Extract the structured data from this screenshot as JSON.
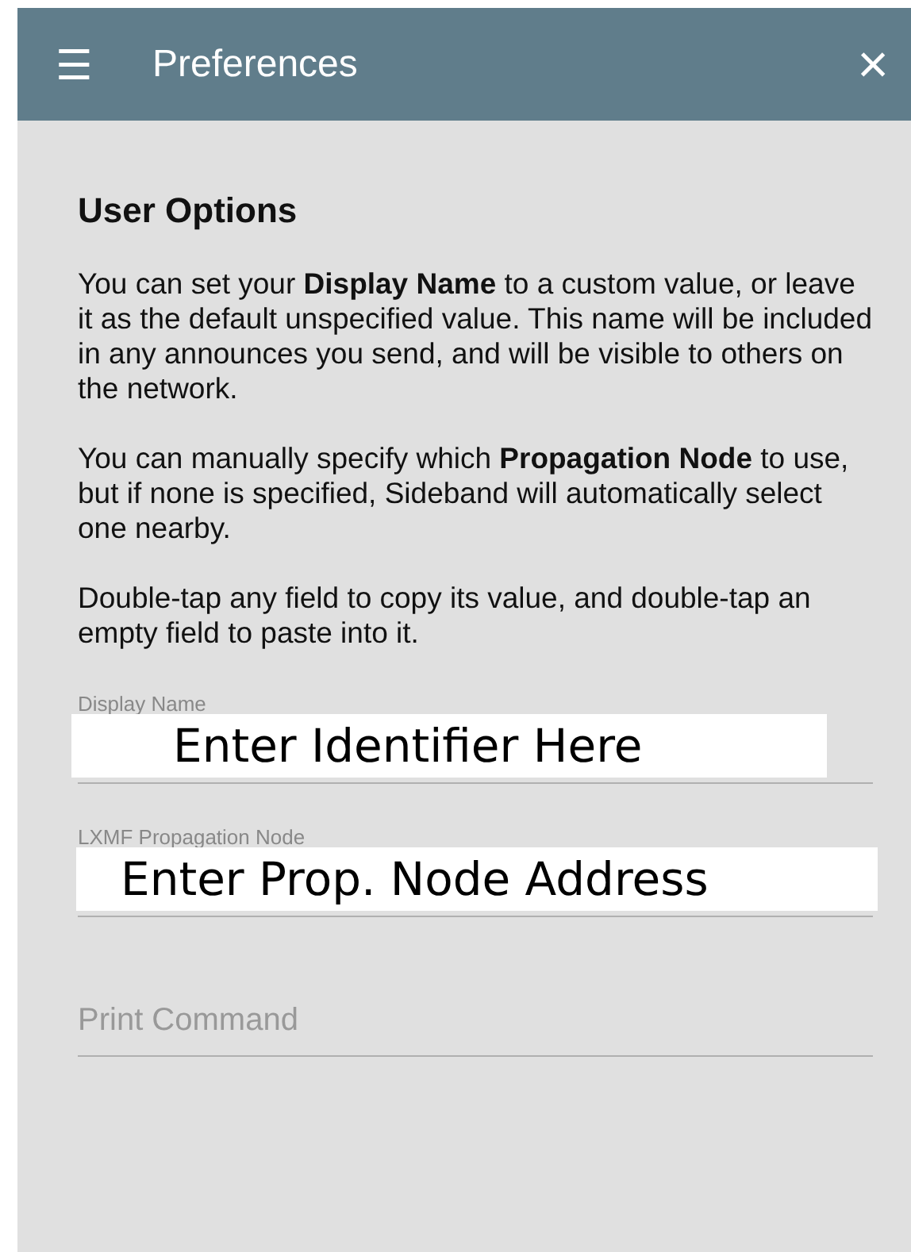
{
  "toolbar": {
    "menu_icon": "☰",
    "title": "Preferences",
    "close_icon": "×"
  },
  "section": {
    "heading": "User Options",
    "paragraphs": [
      "You can set your **Display Name** to a custom value, or leave it as the default unspecified value. This name will be included in any announces you send, and will be visible to others on the network.",
      "You can manually specify which **Propagation Node** to use, but if none is specified, Sideband will automatically select one nearby.",
      "Double-tap any field to copy its value, and double-tap an empty field to paste into it."
    ]
  },
  "fields": [
    {
      "label": "Display Name",
      "value": "Enter Identifier Here"
    },
    {
      "label": "LXMF Propagation Node",
      "value": "Enter Prop. Node Address"
    },
    {
      "placeholder": "Print Command"
    }
  ]
}
